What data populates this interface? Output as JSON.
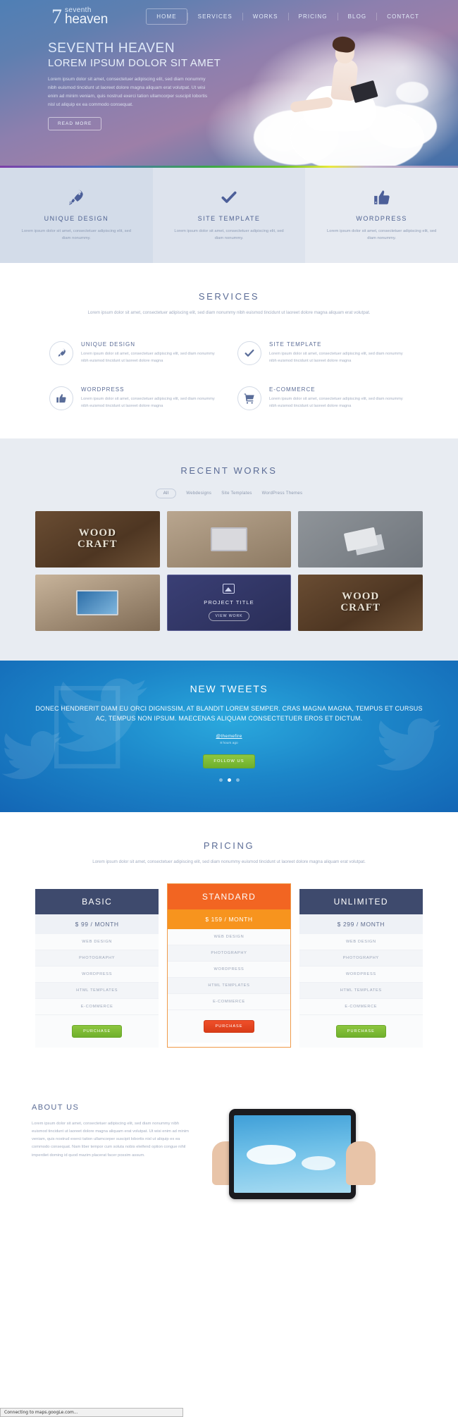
{
  "header": {
    "logo": {
      "seven": "7",
      "line1": "seventh",
      "line2": "heaven"
    },
    "nav": [
      {
        "label": "HOME",
        "active": true
      },
      {
        "label": "SERVICES",
        "active": false
      },
      {
        "label": "WORKS",
        "active": false
      },
      {
        "label": "PRICING",
        "active": false
      },
      {
        "label": "BLOG",
        "active": false
      },
      {
        "label": "CONTACT",
        "active": false
      }
    ]
  },
  "hero": {
    "title": "SEVENTH HEAVEN",
    "subtitle": "LOREM IPSUM DOLOR SIT AMET",
    "paragraph": "Lorem ipsum dolor sit amet, consectetuer adipiscing elit, sed diam nonummy nibh euismod tincidunt ut laoreet dolore magna aliquam erat volutpat. Ut wisi enim ad minim veniam, quis nostrud exerci tation ullamcorper suscipit lobortis nisl ut aliquip ex ea commodo consequat.",
    "button": "READ MORE"
  },
  "features": [
    {
      "icon": "rocket-icon",
      "title": "UNIQUE DESIGN",
      "text": "Lorem ipsum dolor sit amet, consectetuer adipiscing elit, sed diam nonummy."
    },
    {
      "icon": "check-icon",
      "title": "SITE TEMPLATE",
      "text": "Lorem ipsum dolor sit amet, consectetuer adipiscing elit, sed diam nonummy."
    },
    {
      "icon": "thumbs-up-icon",
      "title": "WORDPRESS",
      "text": "Lorem ipsum dolor sit amet, consectetuer adipiscing elit, sed diam nonummy."
    }
  ],
  "services": {
    "title": "SERVICES",
    "subtitle": "Lorem ipsum dolor sit amet, consectetuer adipiscing elit, sed diam nonummy nibh euismod tincidunt ut laoreet dolore magna aliquam erat volutpat.",
    "items": [
      {
        "icon": "rocket-icon",
        "title": "UNIQUE DESIGN",
        "text": "Lorem ipsum dolor sit amet, consectetuer adipiscing elit, sed diam nonummy nibh euismod tincidunt ut laoreet dolore magna"
      },
      {
        "icon": "check-icon",
        "title": "SITE TEMPLATE",
        "text": "Lorem ipsum dolor sit amet, consectetuer adipiscing elit, sed diam nonummy nibh euismod tincidunt ut laoreet dolore magna"
      },
      {
        "icon": "thumbs-up-icon",
        "title": "WORDPRESS",
        "text": "Lorem ipsum dolor sit amet, consectetuer adipiscing elit, sed diam nonummy nibh euismod tincidunt ut laoreet dolore magna"
      },
      {
        "icon": "cart-icon",
        "title": "E-COMMERCE",
        "text": "Lorem ipsum dolor sit amet, consectetuer adipiscing elit, sed diam nonummy nibh euismod tincidunt ut laoreet dolore magna"
      }
    ]
  },
  "works": {
    "title": "RECENT WORKS",
    "filters": [
      {
        "label": "All",
        "active": true
      },
      {
        "label": "Webdesigns",
        "active": false
      },
      {
        "label": "Site Templates",
        "active": false
      },
      {
        "label": "WordPress Themes",
        "active": false
      }
    ],
    "items": [
      {
        "kind": "wood",
        "line1": "WOOD",
        "line2": "CRAFT"
      },
      {
        "kind": "desk",
        "line1": "",
        "line2": ""
      },
      {
        "kind": "cards",
        "line1": "",
        "line2": ""
      },
      {
        "kind": "laptop",
        "line1": "",
        "line2": ""
      },
      {
        "kind": "project",
        "title": "PROJECT TITLE",
        "button": "VIEW WORK"
      },
      {
        "kind": "wood",
        "line1": "WOOD",
        "line2": "CRAFT"
      }
    ]
  },
  "tweets": {
    "title": "NEW TWEETS",
    "text": "DONEC HENDRERIT DIAM EU ORCI DIGNISSIM, AT BLANDIT LOREM SEMPER. CRAS MAGNA MAGNA, TEMPUS ET CURSUS AC, TEMPUS NON IPSUM. MAECENAS ALIQUAM CONSECTETUER EROS ET DICTUM.",
    "handle": "@themefire",
    "time": "8 hours ago",
    "button": "FOLLOW US",
    "dots": [
      false,
      true,
      false
    ]
  },
  "pricing": {
    "title": "PRICING",
    "subtitle": "Lorem ipsum dolor sit amet, consectetuer adipiscing elit, sed diam nonummy euismod tincidunt ut laoreet dolore magna aliquam erat volutpat.",
    "plans": [
      {
        "name": "BASIC",
        "price": "$ 99 / MONTH",
        "featured": false,
        "features": [
          "WEB DESIGN",
          "PHOTOGRAPHY",
          "WORDPRESS",
          "HTML TEMPLATES",
          "E-COMMERCE"
        ],
        "button": "PURCHASE"
      },
      {
        "name": "STANDARD",
        "price": "$ 159 / MONTH",
        "featured": true,
        "features": [
          "WEB DESIGN",
          "PHOTOGRAPHY",
          "WORDPRESS",
          "HTML TEMPLATES",
          "E-COMMERCE"
        ],
        "button": "PURCHASE"
      },
      {
        "name": "UNLIMITED",
        "price": "$ 299 / MONTH",
        "featured": false,
        "features": [
          "WEB DESIGN",
          "PHOTOGRAPHY",
          "WORDPRESS",
          "HTML TEMPLATES",
          "E-COMMERCE"
        ],
        "button": "PURCHASE"
      }
    ]
  },
  "about": {
    "title": "ABOUT US",
    "text": "Lorem ipsum dolor sit amet, consectetuer adipiscing elit, sed diam nonummy nibh euismod tincidunt ut laoreet dolore magna aliquam erat volutpat. Ut wisi enim ad minim veniam, quis nostrud exerci tation ullamcorper suscipit lobortis nisl ut aliquip ex ea commodo consequat. Nam liber tempor cum soluta nobis eleifend option congue nihil imperdiet doming id quod mazim placerat facer possim assum."
  },
  "statusbar": {
    "text": "Connecting to maps.googLe.com..."
  },
  "colors": {
    "brand_blue": "#4f6291",
    "orange": "#f26522",
    "orange_light": "#f7941e",
    "green": "#8dc63f",
    "dark_navy": "#3e4a6d",
    "tweet_blue": "#1c86c9"
  }
}
